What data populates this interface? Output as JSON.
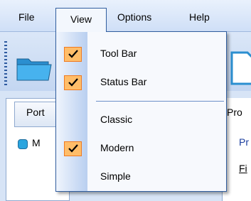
{
  "menubar": {
    "items": [
      {
        "label": "File"
      },
      {
        "label": "View"
      },
      {
        "label": "Options"
      },
      {
        "label": "Help"
      }
    ]
  },
  "view_menu": {
    "items": [
      {
        "label": "Tool Bar",
        "checked": true
      },
      {
        "label": "Status Bar",
        "checked": true
      },
      {
        "label": "Classic",
        "checked": false
      },
      {
        "label": "Modern",
        "checked": true
      },
      {
        "label": "Simple",
        "checked": false
      }
    ]
  },
  "left_panel": {
    "tab_label": "Port",
    "node_label": "M"
  },
  "right_panel": {
    "tab_label": "Pro",
    "link1": "Pr",
    "link2": "Fi"
  },
  "colors": {
    "check_fill": "#ffbd69",
    "check_border": "#f07a20",
    "menu_border": "#315e9f",
    "accent": "#1a3d9e"
  },
  "icons": [
    "folder-icon",
    "document-icon",
    "checkmark-icon",
    "grip-handle"
  ]
}
